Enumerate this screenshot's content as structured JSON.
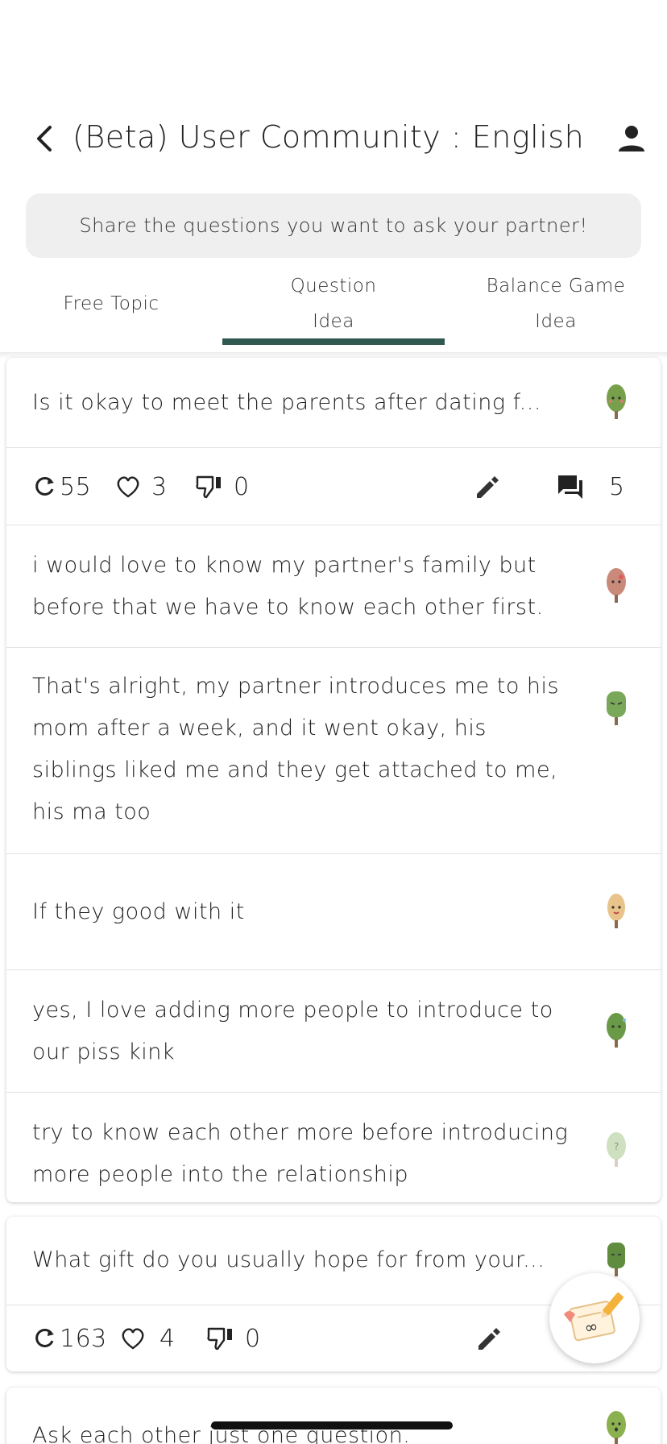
{
  "header": {
    "title": "(Beta) User Community : English",
    "banner": "Share the questions you want to ask your partner!"
  },
  "tabs": [
    {
      "label": "Free Topic"
    },
    {
      "label_line1": "Question",
      "label_line2": "Idea",
      "selected": true
    },
    {
      "label_line1": "Balance Game",
      "label_line2": "Idea"
    }
  ],
  "accent_color": "#2f5850",
  "posts": [
    {
      "question": "Is it okay to meet the parents after dating f...",
      "repost_count": "55",
      "like_count": "3",
      "dislike_count": "0",
      "comment_count": "5",
      "comments": [
        {
          "text": "i would love to know my partner's family but before that we have to know each other first.",
          "avatar_color": "#c98a7a"
        },
        {
          "text": "That's alright, my partner introduces me to his mom after a week, and it went okay, his siblings liked me and they get attached to me, his ma too",
          "avatar_color": "#7aa85a"
        },
        {
          "text": "If they good with it",
          "avatar_color": "#e8c48a"
        },
        {
          "text": "yes, I love adding more people to introduce to our piss kink",
          "avatar_color": "#6a9a48"
        },
        {
          "text": "try to know each other more before introducing more people into the relationship",
          "avatar_color": "#cfe0c0"
        }
      ],
      "avatar_color": "#78a04a"
    },
    {
      "question": "What gift do you usually hope for from your...",
      "repost_count": "163",
      "like_count": "4",
      "dislike_count": "0",
      "avatar_color": "#5f8c3e"
    },
    {
      "question": "Ask each other just one question.",
      "avatar_color": "#8ab04f"
    }
  ]
}
